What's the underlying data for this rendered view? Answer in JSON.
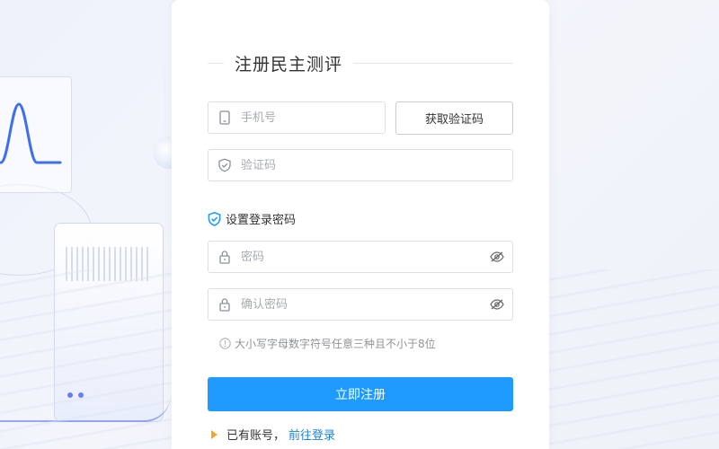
{
  "register": {
    "title": "注册民主测评",
    "phone": {
      "placeholder": "手机号",
      "value": ""
    },
    "get_code_label": "获取验证码",
    "code": {
      "placeholder": "验证码",
      "value": ""
    },
    "password_section_label": "设置登录密码",
    "password": {
      "placeholder": "密码",
      "value": ""
    },
    "confirm_password": {
      "placeholder": "确认密码",
      "value": ""
    },
    "password_hint": "大小写字母数字符号任意三种且不小于8位",
    "submit_label": "立即注册",
    "have_account_text": "已有账号，",
    "login_link": "前往登录"
  },
  "colors": {
    "primary": "#1f9bff",
    "link": "#1f82d6",
    "accent_triangle": "#f5a623",
    "shield": "#1f9bff"
  },
  "icons": {
    "phone": "phone-icon",
    "code": "shield-check-icon",
    "section": "shield-check-icon",
    "password": "lock-icon",
    "eye": "eye-icon",
    "hint": "info-icon"
  }
}
